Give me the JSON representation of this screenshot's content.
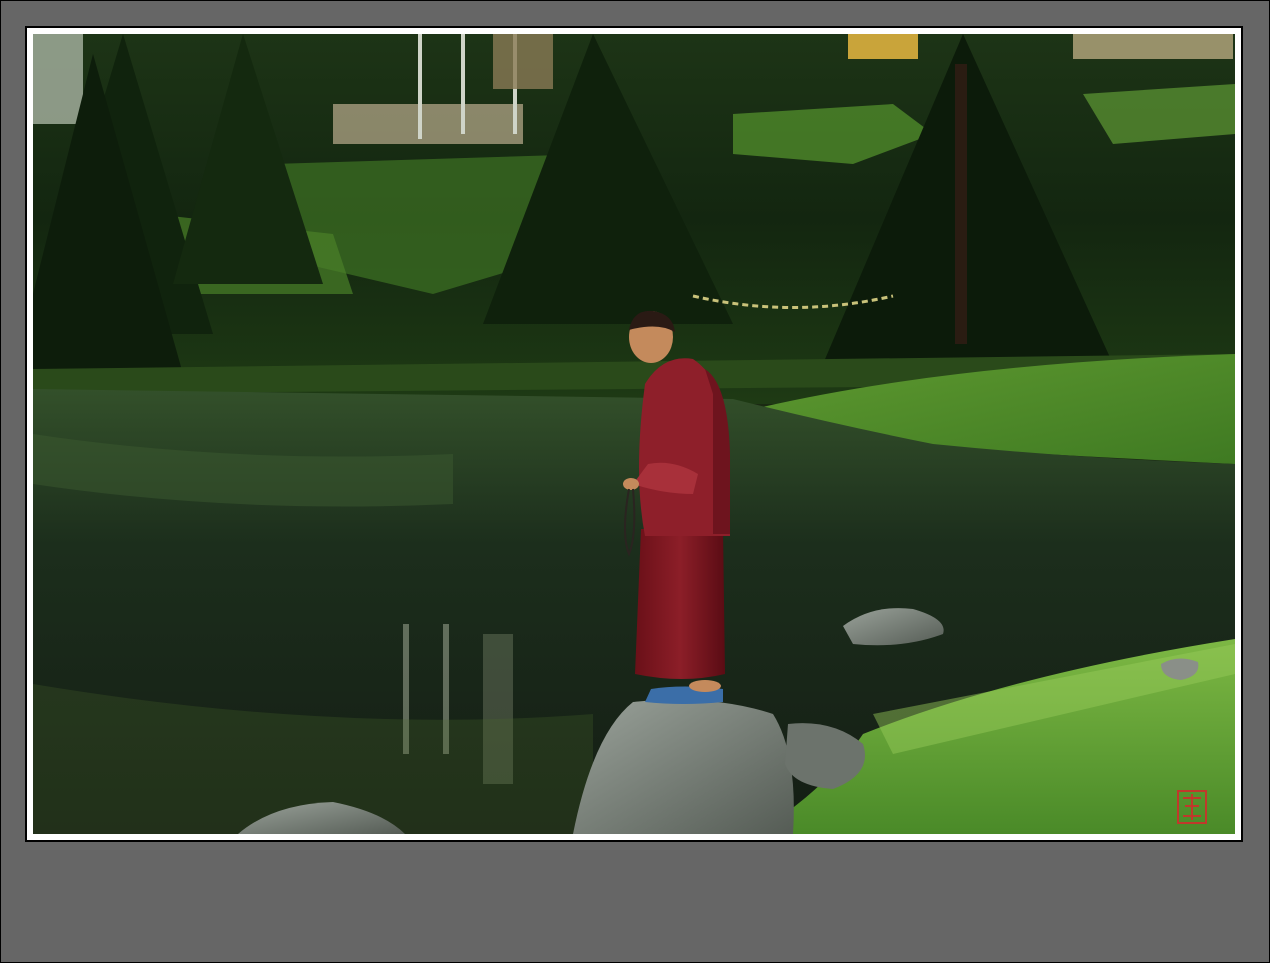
{
  "frame": {
    "background_color": "#666666",
    "mat_color": "#ffffff"
  },
  "photo": {
    "colors": {
      "forest_dark": "#0f1e0c",
      "forest_mid": "#22401a",
      "grass_bright": "#6fa83a",
      "water_dark": "#17241a",
      "water_reflect": "#3c5a30",
      "robe": "#7a1a22",
      "robe_light": "#a8303a",
      "rock": "#7a8078"
    },
    "seal": {
      "color": "#c0392b"
    }
  }
}
